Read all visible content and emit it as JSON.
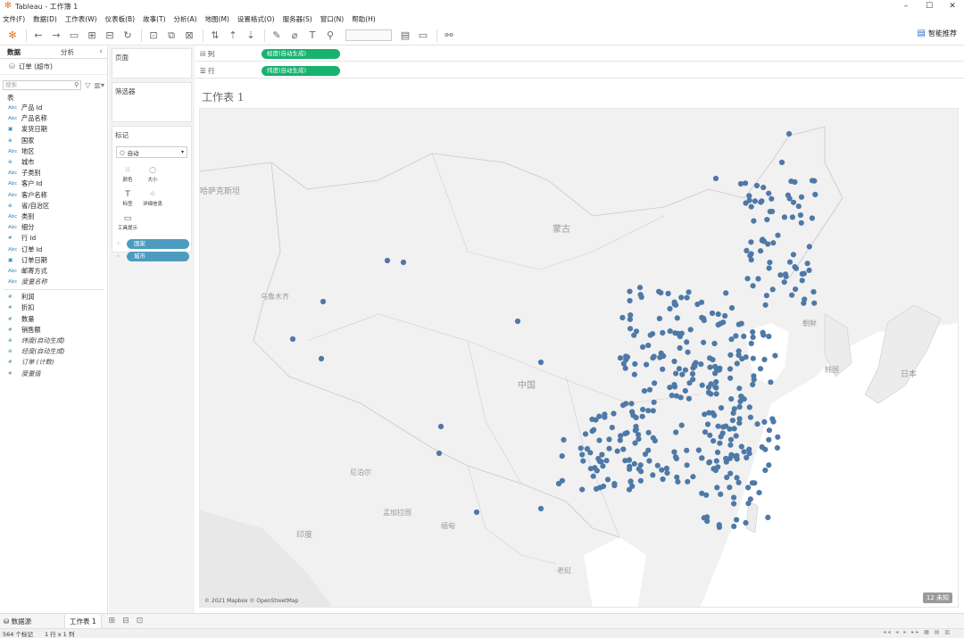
{
  "window": {
    "title": "Tableau - 工作簿 1"
  },
  "menu": [
    "文件(F)",
    "数据(D)",
    "工作表(W)",
    "仪表板(B)",
    "故事(T)",
    "分析(A)",
    "地图(M)",
    "设置格式(O)",
    "服务器(S)",
    "窗口(N)",
    "帮助(H)"
  ],
  "toolbar": {
    "smart_label": "智能推荐"
  },
  "leftpane": {
    "tab_data": "数据",
    "tab_analysis": "分析",
    "datasource": "订单 (超市)",
    "search_placeholder": "搜索",
    "section": "表",
    "fields": [
      {
        "type": "Abc",
        "name": "产品 Id"
      },
      {
        "type": "Abc",
        "name": "产品名称"
      },
      {
        "type": "▣",
        "name": "发货日期"
      },
      {
        "type": "⊕",
        "name": "国家"
      },
      {
        "type": "Abc",
        "name": "地区"
      },
      {
        "type": "⊕",
        "name": "城市"
      },
      {
        "type": "Abc",
        "name": "子类别"
      },
      {
        "type": "Abc",
        "name": "客户 Id"
      },
      {
        "type": "Abc",
        "name": "客户名称"
      },
      {
        "type": "⊕",
        "name": "省/自治区"
      },
      {
        "type": "Abc",
        "name": "类别"
      },
      {
        "type": "Abc",
        "name": "细分"
      },
      {
        "type": "#",
        "name": "行 Id"
      },
      {
        "type": "Abc",
        "name": "订单 Id"
      },
      {
        "type": "▣",
        "name": "订单日期"
      },
      {
        "type": "Abc",
        "name": "邮寄方式"
      },
      {
        "type": "Abc",
        "name": "度量名称"
      }
    ],
    "measures": [
      {
        "type": "#",
        "name": "利润"
      },
      {
        "type": "#",
        "name": "折扣"
      },
      {
        "type": "#",
        "name": "数量"
      },
      {
        "type": "#",
        "name": "销售额"
      },
      {
        "type": "⊕",
        "name": "纬度(自动生成)"
      },
      {
        "type": "⊕",
        "name": "经度(自动生成)"
      },
      {
        "type": "#",
        "name": "订单 (计数)"
      },
      {
        "type": "#",
        "name": "度量值"
      }
    ]
  },
  "cards": {
    "pages": "页面",
    "filters": "筛选器",
    "marks": "标记",
    "mark_type": "自动",
    "mark_buttons": [
      {
        "icon": "⁙",
        "label": "颜色"
      },
      {
        "icon": "◌",
        "label": "大小"
      },
      {
        "icon": "T",
        "label": "标签"
      },
      {
        "icon": "⁘",
        "label": "详细信息"
      },
      {
        "icon": "▭",
        "label": "工具提示"
      }
    ],
    "pills": [
      "国家",
      "城市"
    ]
  },
  "shelves": {
    "columns_label": "列",
    "columns_pill": "经度(自动生成)",
    "rows_label": "行",
    "rows_pill": "纬度(自动生成)"
  },
  "view": {
    "sheet_title": "工作表 1",
    "map_labels": [
      "哈萨克斯坦",
      "蒙古",
      "乌鲁木齐",
      "中国",
      "尼泊尔",
      "印度",
      "孟加拉国",
      "缅甸",
      "朝鲜",
      "韩国",
      "日本",
      "老挝"
    ],
    "attribution": "© 2021 Mapbox © OpenStreetMap",
    "count_badge": "12 未知",
    "dot_color": "#4e79a7"
  },
  "bottom": {
    "datasource_tab": "数据源",
    "sheet_tab": "工作表 1",
    "status_marks": "564 个标记",
    "status_rowcol": "1 行 x 1 列"
  }
}
